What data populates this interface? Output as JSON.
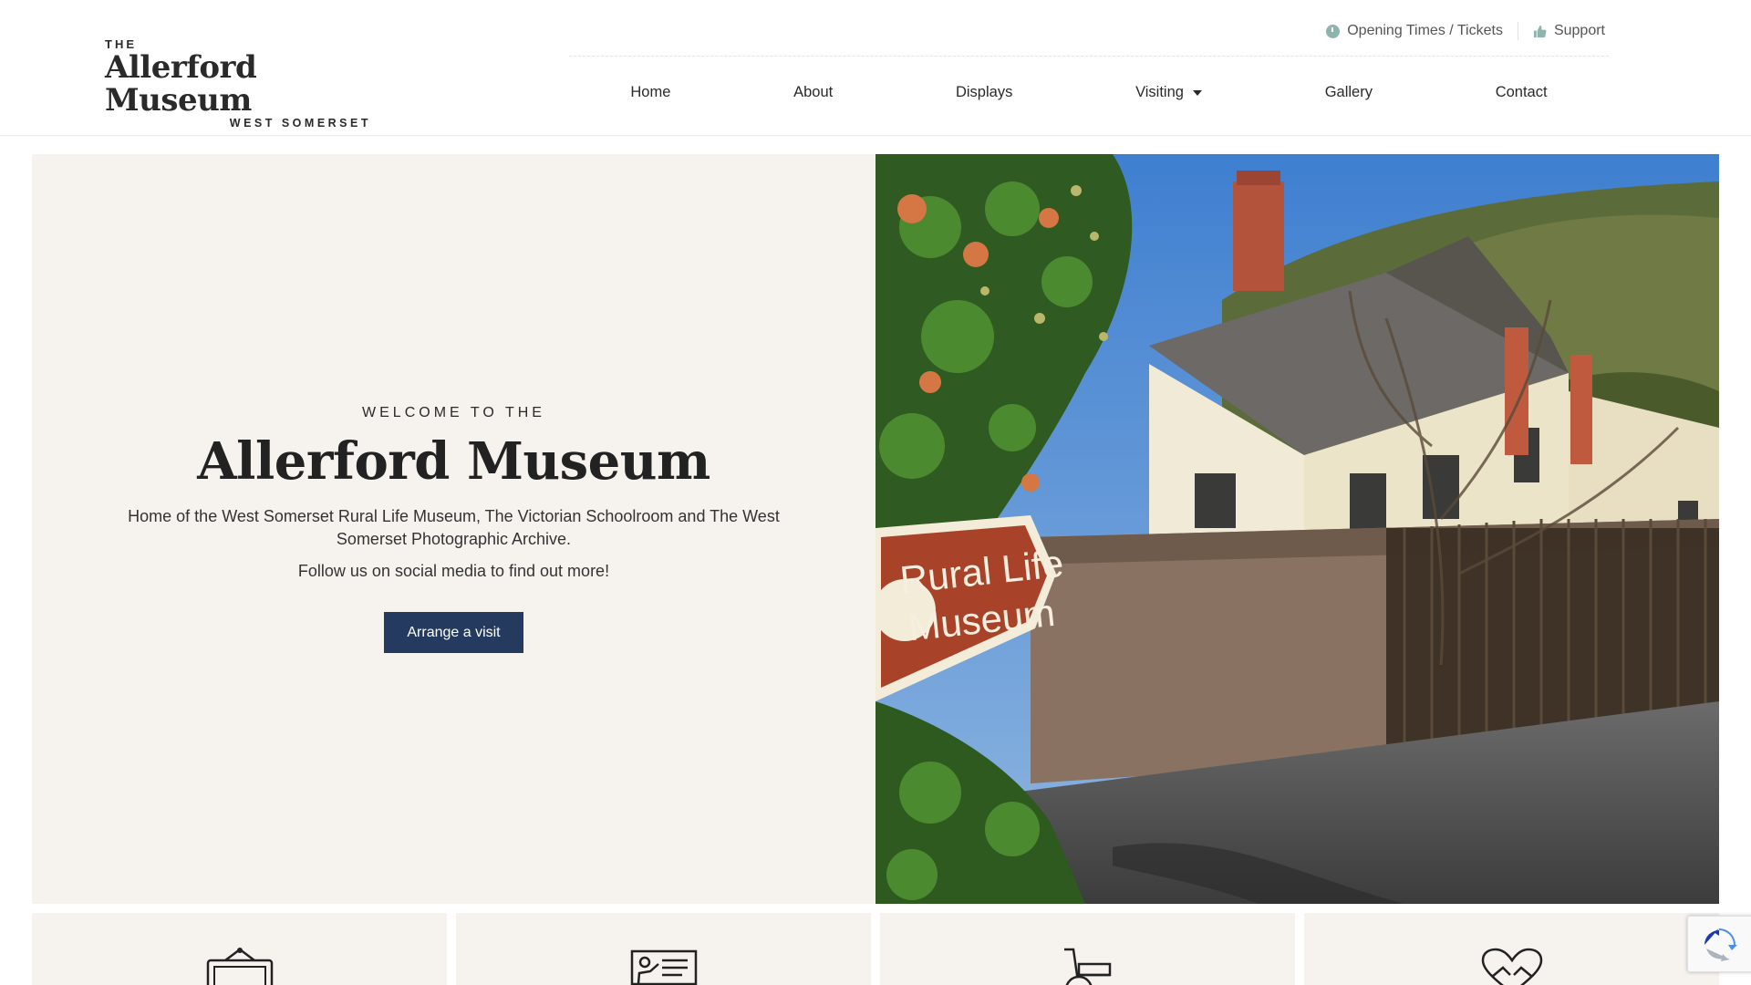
{
  "logo": {
    "the": "THE",
    "name": "Allerford Museum",
    "sub": "WEST SOMERSET"
  },
  "topbar": {
    "opening": {
      "label": "Opening Times / Tickets",
      "icon": "clock-icon"
    },
    "support": {
      "label": "Support",
      "icon": "thumbs-up-icon"
    }
  },
  "nav": {
    "items": [
      {
        "label": "Home"
      },
      {
        "label": "About"
      },
      {
        "label": "Displays"
      },
      {
        "label": "Visiting",
        "has_dropdown": true
      },
      {
        "label": "Gallery"
      },
      {
        "label": "Contact"
      }
    ]
  },
  "hero": {
    "eyebrow": "WELCOME TO THE",
    "title": "Allerford Museum",
    "description": "Home of the West Somerset Rural Life Museum, The Victorian Schoolroom and The West Somerset Photographic Archive.",
    "follow": "Follow us on social media to find out more!",
    "cta_label": "Arrange a visit",
    "image": {
      "sign_line1": "Rural Life",
      "sign_line2": "Museum"
    }
  },
  "cards": [
    {
      "icon": "framed-picture-icon"
    },
    {
      "icon": "presenter-board-icon"
    },
    {
      "icon": "wheelchair-icon"
    },
    {
      "icon": "heart-hands-icon"
    }
  ],
  "colors": {
    "accent": "#243a5e",
    "panel_bg": "#f6f3ef",
    "topbar_icon": "#8fb3ad",
    "sign_red": "#a8432a"
  }
}
